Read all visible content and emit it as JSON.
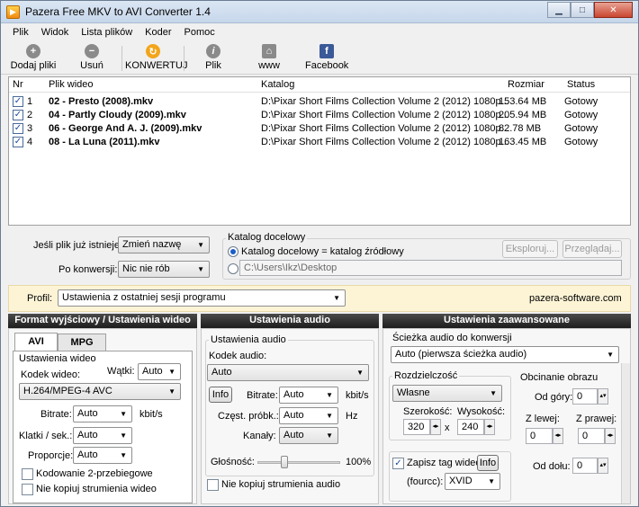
{
  "window": {
    "title": "Pazera Free MKV to AVI Converter 1.4"
  },
  "menu": [
    "Plik",
    "Widok",
    "Lista plików",
    "Koder",
    "Pomoc"
  ],
  "toolbar": {
    "add": "Dodaj pliki",
    "remove": "Usuń",
    "convert": "KONWERTUJ",
    "file": "Plik",
    "www": "www",
    "facebook": "Facebook"
  },
  "list": {
    "headers": {
      "nr": "Nr",
      "file": "Plik wideo",
      "dir": "Katalog",
      "size": "Rozmiar",
      "status": "Status"
    },
    "rows": [
      {
        "nr": "1",
        "file": "02 - Presto (2008).mkv",
        "dir": "D:\\Pixar Short Films Collection Volume 2 (2012) 1080p...",
        "size": "153.64 MB",
        "status": "Gotowy"
      },
      {
        "nr": "2",
        "file": "04 - Partly Cloudy (2009).mkv",
        "dir": "D:\\Pixar Short Films Collection Volume 2 (2012) 1080p...",
        "size": "205.94 MB",
        "status": "Gotowy"
      },
      {
        "nr": "3",
        "file": "06 - George And A. J. (2009).mkv",
        "dir": "D:\\Pixar Short Films Collection Volume 2 (2012) 1080p...",
        "size": "82.78 MB",
        "status": "Gotowy"
      },
      {
        "nr": "4",
        "file": "08 - La Luna (2011).mkv",
        "dir": "D:\\Pixar Short Films Collection Volume 2 (2012) 1080p...",
        "size": "163.45 MB",
        "status": "Gotowy"
      }
    ]
  },
  "options": {
    "exists_label": "Jeśli plik już istnieje:",
    "exists_value": "Zmień nazwę",
    "after_label": "Po konwersji:",
    "after_value": "Nic nie rób",
    "outdir_group": "Katalog docelowy",
    "outdir_same": "Katalog docelowy = katalog źródłowy",
    "outdir_path": "C:\\Users\\Ikz\\Desktop",
    "explore": "Eksploruj...",
    "browse": "Przeglądaj..."
  },
  "profile": {
    "label": "Profil:",
    "value": "Ustawienia z ostatniej sesji programu",
    "site": "pazera-software.com"
  },
  "video": {
    "header": "Format wyjściowy / Ustawienia wideo",
    "tab_avi": "AVI",
    "tab_mpg": "MPG",
    "group": "Ustawienia wideo",
    "codec_label": "Kodek wideo:",
    "threads_label": "Wątki:",
    "threads_value": "Auto",
    "codec_value": "H.264/MPEG-4 AVC",
    "bitrate_label": "Bitrate:",
    "bitrate_value": "Auto",
    "bitrate_unit": "kbit/s",
    "fps_label": "Klatki / sek.:",
    "fps_value": "Auto",
    "aspect_label": "Proporcje:",
    "aspect_value": "Auto",
    "twopass": "Kodowanie 2-przebiegowe",
    "nocopy": "Nie kopiuj strumienia wideo"
  },
  "audio": {
    "header": "Ustawienia audio",
    "group": "Ustawienia audio",
    "codec_label": "Kodek audio:",
    "codec_value": "Auto",
    "info": "Info",
    "bitrate_label": "Bitrate:",
    "bitrate_value": "Auto",
    "bitrate_unit": "kbit/s",
    "freq_label": "Częst. próbk.:",
    "freq_value": "Auto",
    "freq_unit": "Hz",
    "channels_label": "Kanały:",
    "channels_value": "Auto",
    "volume_label": "Głośność:",
    "volume_value": "100%",
    "nocopy": "Nie kopiuj strumienia audio"
  },
  "advanced": {
    "header": "Ustawienia zaawansowane",
    "track_label": "Ścieżka audio do konwersji",
    "track_value": "Auto (pierwsza ścieżka audio)",
    "res_group": "Rozdzielczość",
    "res_value": "Własne",
    "width_label": "Szerokość:",
    "height_label": "Wysokość:",
    "width_value": "320",
    "x": "x",
    "height_value": "240",
    "crop_group": "Obcinanie obrazu",
    "top_label": "Od góry:",
    "top_value": "0",
    "left_label": "Z lewej:",
    "left_value": "0",
    "right_label": "Z prawej:",
    "right_value": "0",
    "bottom_label": "Od dołu:",
    "bottom_value": "0",
    "tag_label": "Zapisz tag wideo",
    "info": "Info",
    "fourcc_label": "(fourcc):",
    "fourcc_value": "XVID"
  }
}
